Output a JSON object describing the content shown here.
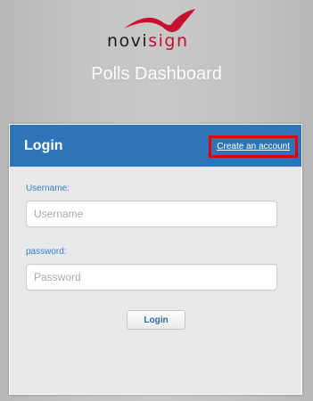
{
  "brand": {
    "logo_prefix": "novi",
    "logo_suffix": "sign",
    "accent_color": "#c8102e"
  },
  "page": {
    "title": "Polls Dashboard"
  },
  "login_panel": {
    "title": "Login",
    "create_account_link": "Create an account",
    "header_color": "#2e74b9",
    "username": {
      "label": "Username:",
      "placeholder": "Username",
      "value": ""
    },
    "password": {
      "label": "password:",
      "placeholder": "Password",
      "value": ""
    },
    "submit_label": "Login"
  }
}
